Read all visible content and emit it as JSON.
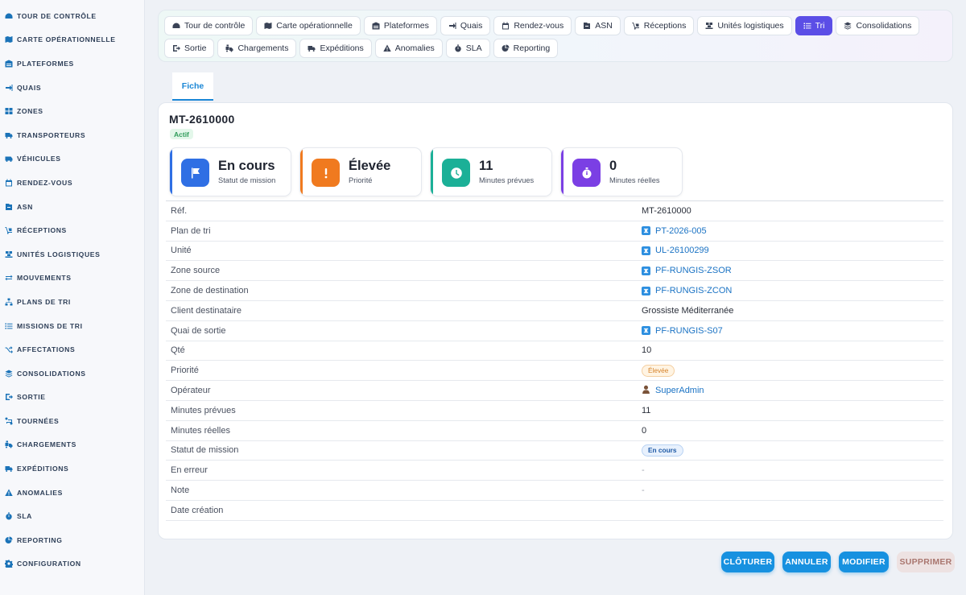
{
  "sidebar": {
    "items": [
      {
        "label": "TOUR DE CONTRÔLE",
        "icon": "dashboard-icon"
      },
      {
        "label": "CARTE OPÉRATIONNELLE",
        "icon": "map-icon"
      },
      {
        "label": "PLATEFORMES",
        "icon": "warehouse-icon"
      },
      {
        "label": "QUAIS",
        "icon": "dock-icon"
      },
      {
        "label": "ZONES",
        "icon": "grid-icon"
      },
      {
        "label": "TRANSPORTEURS",
        "icon": "truck-icon"
      },
      {
        "label": "VÉHICULES",
        "icon": "van-icon"
      },
      {
        "label": "RENDEZ-VOUS",
        "icon": "calendar-icon"
      },
      {
        "label": "ASN",
        "icon": "asn-icon"
      },
      {
        "label": "RÉCEPTIONS",
        "icon": "dolly-icon"
      },
      {
        "label": "UNITÉS LOGISTIQUES",
        "icon": "pallet-icon"
      },
      {
        "label": "MOUVEMENTS",
        "icon": "arrows-icon"
      },
      {
        "label": "PLANS DE TRI",
        "icon": "sitemap-icon"
      },
      {
        "label": "MISSIONS DE TRI",
        "icon": "tasks-icon"
      },
      {
        "label": "AFFECTATIONS",
        "icon": "shuffle-icon"
      },
      {
        "label": "CONSOLIDATIONS",
        "icon": "layers-icon"
      },
      {
        "label": "SORTIE",
        "icon": "exit-icon"
      },
      {
        "label": "TOURNÉES",
        "icon": "route-icon"
      },
      {
        "label": "CHARGEMENTS",
        "icon": "loading-icon"
      },
      {
        "label": "EXPÉDITIONS",
        "icon": "shipping-icon"
      },
      {
        "label": "ANOMALIES",
        "icon": "warning-icon"
      },
      {
        "label": "SLA",
        "icon": "stopwatch-icon"
      },
      {
        "label": "REPORTING",
        "icon": "chart-pie-icon"
      },
      {
        "label": "CONFIGURATION",
        "icon": "gear-icon"
      }
    ]
  },
  "topnav": {
    "row1": [
      {
        "label": "Tour de contrôle",
        "icon": "dashboard-icon"
      },
      {
        "label": "Carte opérationnelle",
        "icon": "map-icon"
      },
      {
        "label": "Plateformes",
        "icon": "warehouse-icon"
      },
      {
        "label": "Quais",
        "icon": "dock-icon"
      },
      {
        "label": "Rendez-vous",
        "icon": "calendar-icon"
      },
      {
        "label": "ASN",
        "icon": "asn-icon"
      },
      {
        "label": "Réceptions",
        "icon": "dolly-icon"
      },
      {
        "label": "Unités logistiques",
        "icon": "pallet-icon"
      },
      {
        "label": "Tri",
        "icon": "tasks-icon",
        "active": true
      },
      {
        "label": "Consolidations",
        "icon": "layers-icon"
      }
    ],
    "row2": [
      {
        "label": "Sortie",
        "icon": "exit-icon"
      },
      {
        "label": "Chargements",
        "icon": "loading-icon"
      },
      {
        "label": "Expéditions",
        "icon": "shipping-icon"
      },
      {
        "label": "Anomalies",
        "icon": "warning-icon"
      },
      {
        "label": "SLA",
        "icon": "stopwatch-icon"
      },
      {
        "label": "Reporting",
        "icon": "chart-pie-icon"
      }
    ]
  },
  "tabs": {
    "fiche": "Fiche"
  },
  "record": {
    "title": "MT-2610000",
    "status_badge": "Actif"
  },
  "kpis": [
    {
      "value": "En cours",
      "label": "Statut de mission",
      "icon": "flag-icon",
      "color": "#2f6fe4"
    },
    {
      "value": "Élevée",
      "label": "Priorité",
      "icon": "exclamation-icon",
      "color": "#f07a1f"
    },
    {
      "value": "11",
      "label": "Minutes prévues",
      "icon": "clock-icon",
      "color": "#1bb097"
    },
    {
      "value": "0",
      "label": "Minutes réelles",
      "icon": "stopwatch-icon",
      "color": "#7b3fe4"
    }
  ],
  "details": {
    "ref": {
      "label": "Réf.",
      "value": "MT-2610000"
    },
    "plan_tri": {
      "label": "Plan de tri",
      "value": "PT-2026-005"
    },
    "unite": {
      "label": "Unité",
      "value": "UL-26100299"
    },
    "zone_source": {
      "label": "Zone source",
      "value": "PF-RUNGIS-ZSOR"
    },
    "zone_dest": {
      "label": "Zone de destination",
      "value": "PF-RUNGIS-ZCON"
    },
    "client": {
      "label": "Client destinataire",
      "value": "Grossiste Méditerranée"
    },
    "quai": {
      "label": "Quai de sortie",
      "value": "PF-RUNGIS-S07"
    },
    "qte": {
      "label": "Qté",
      "value": "10"
    },
    "priorite": {
      "label": "Priorité",
      "value": "Élevée"
    },
    "operateur": {
      "label": "Opérateur",
      "value": "SuperAdmin"
    },
    "min_prevues": {
      "label": "Minutes prévues",
      "value": "11"
    },
    "min_reelles": {
      "label": "Minutes réelles",
      "value": "0"
    },
    "statut": {
      "label": "Statut de mission",
      "value": "En cours"
    },
    "en_erreur": {
      "label": "En erreur",
      "value": "-"
    },
    "note": {
      "label": "Note",
      "value": "-"
    },
    "date_creation": {
      "label": "Date création",
      "value": ""
    }
  },
  "actions": {
    "cloturer": "CLÔTURER",
    "annuler": "ANNULER",
    "modifier": "MODIFIER",
    "supprimer": "SUPPRIMER"
  }
}
